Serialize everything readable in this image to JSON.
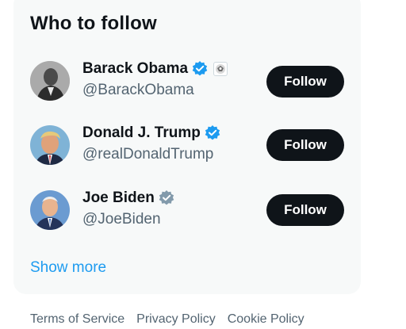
{
  "panel": {
    "title": "Who to follow",
    "show_more": "Show more"
  },
  "accounts": [
    {
      "name": "Barack Obama",
      "handle": "@BarackObama",
      "follow_label": "Follow",
      "badge": "blue-verified",
      "badge_color": "#1d9bf0",
      "affiliate_icon": "government-seal-icon"
    },
    {
      "name": "Donald J. Trump",
      "handle": "@realDonaldTrump",
      "follow_label": "Follow",
      "badge": "blue-verified",
      "badge_color": "#1d9bf0"
    },
    {
      "name": "Joe Biden",
      "handle": "@JoeBiden",
      "follow_label": "Follow",
      "badge": "grey-verified",
      "badge_color": "#829aab"
    }
  ],
  "footer": {
    "links": [
      "Terms of Service",
      "Privacy Policy",
      "Cookie Policy"
    ]
  },
  "colors": {
    "panel_bg": "#f7f9f9",
    "button_bg": "#0f1419",
    "link": "#1d9bf0",
    "secondary_text": "#536471"
  }
}
